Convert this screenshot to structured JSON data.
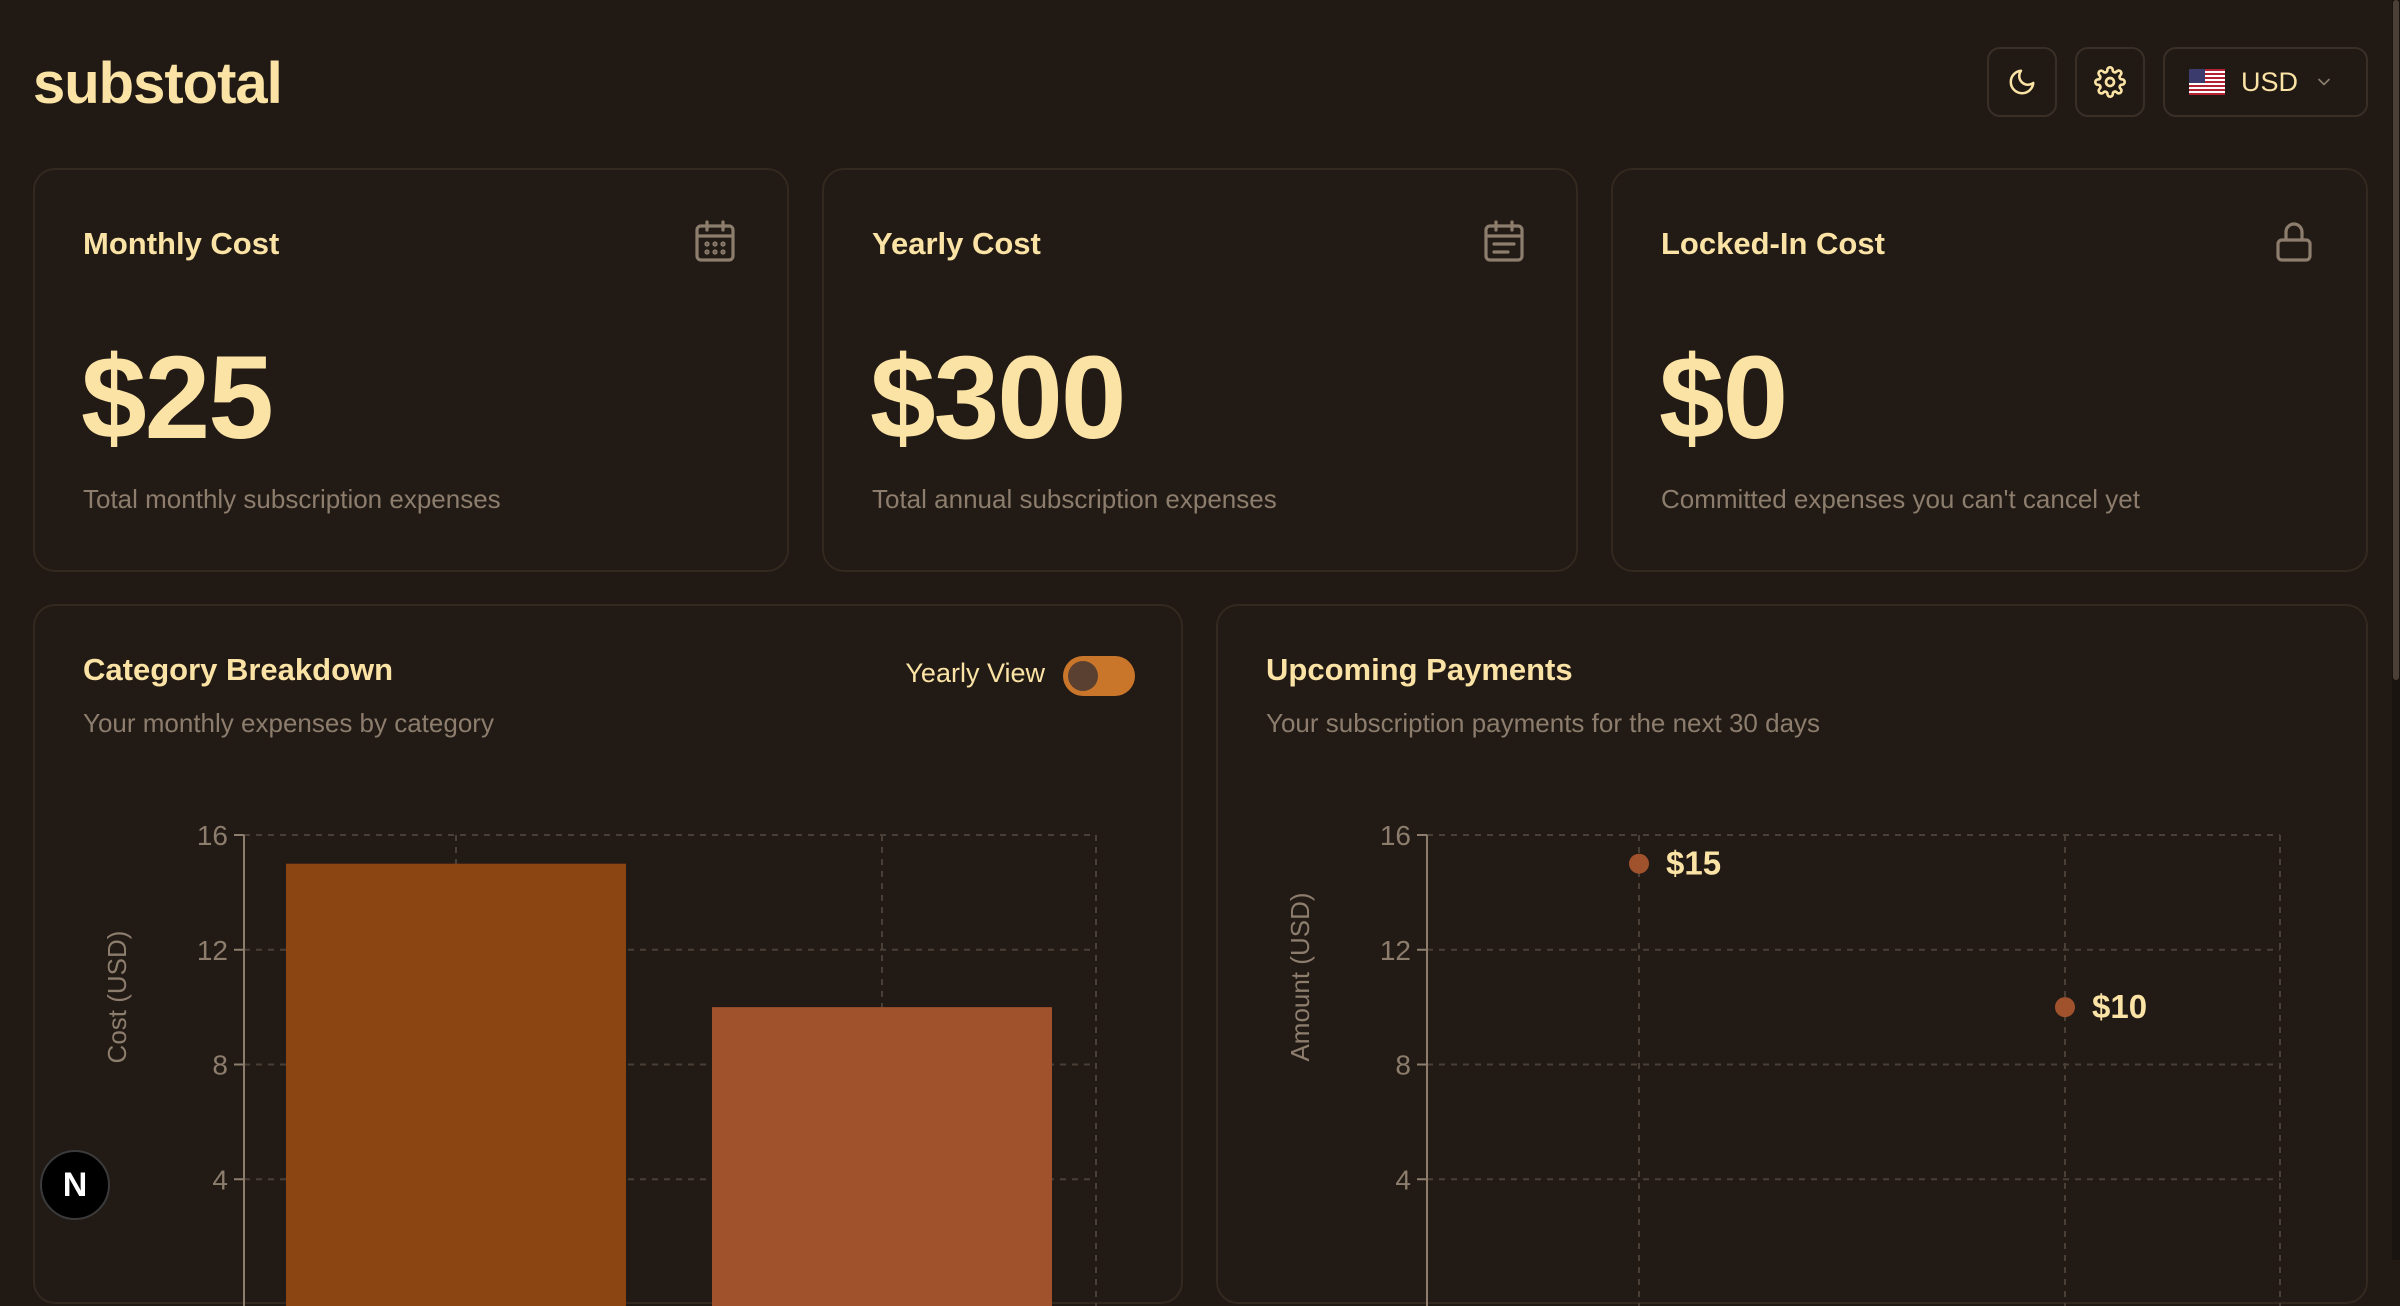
{
  "header": {
    "logo": "substotal",
    "theme_icon": "moon-icon",
    "settings_icon": "gear-icon",
    "currency": "USD",
    "flag_icon": "us-flag-icon"
  },
  "summary_cards": [
    {
      "title": "Monthly Cost",
      "value": "$25",
      "subtitle": "Total monthly subscription expenses",
      "icon": "calendar-icon"
    },
    {
      "title": "Yearly Cost",
      "value": "$300",
      "subtitle": "Total annual subscription expenses",
      "icon": "calendar-list-icon"
    },
    {
      "title": "Locked-In Cost",
      "value": "$0",
      "subtitle": "Committed expenses you can't cancel yet",
      "icon": "lock-icon"
    }
  ],
  "category_panel": {
    "title": "Category Breakdown",
    "subtitle": "Your monthly expenses by category",
    "toggle_label": "Yearly View",
    "toggle_on": true
  },
  "payments_panel": {
    "title": "Upcoming Payments",
    "subtitle": "Your subscription payments for the next 30 days"
  },
  "chart_data": [
    {
      "type": "bar",
      "ylabel": "Cost (USD)",
      "yticks": [
        4,
        8,
        12,
        16
      ],
      "ylim": [
        0,
        16
      ],
      "grid": true,
      "values": [
        15,
        10
      ],
      "colors": [
        "#8b4513",
        "#a0522d"
      ]
    },
    {
      "type": "scatter",
      "ylabel": "Amount (USD)",
      "yticks": [
        4,
        8,
        12,
        16
      ],
      "ylim": [
        0,
        16
      ],
      "grid": true,
      "points": [
        {
          "y": 15,
          "label": "$15"
        },
        {
          "y": 10,
          "label": "$10"
        }
      ],
      "color": "#a0522d"
    }
  ],
  "badge": "N"
}
